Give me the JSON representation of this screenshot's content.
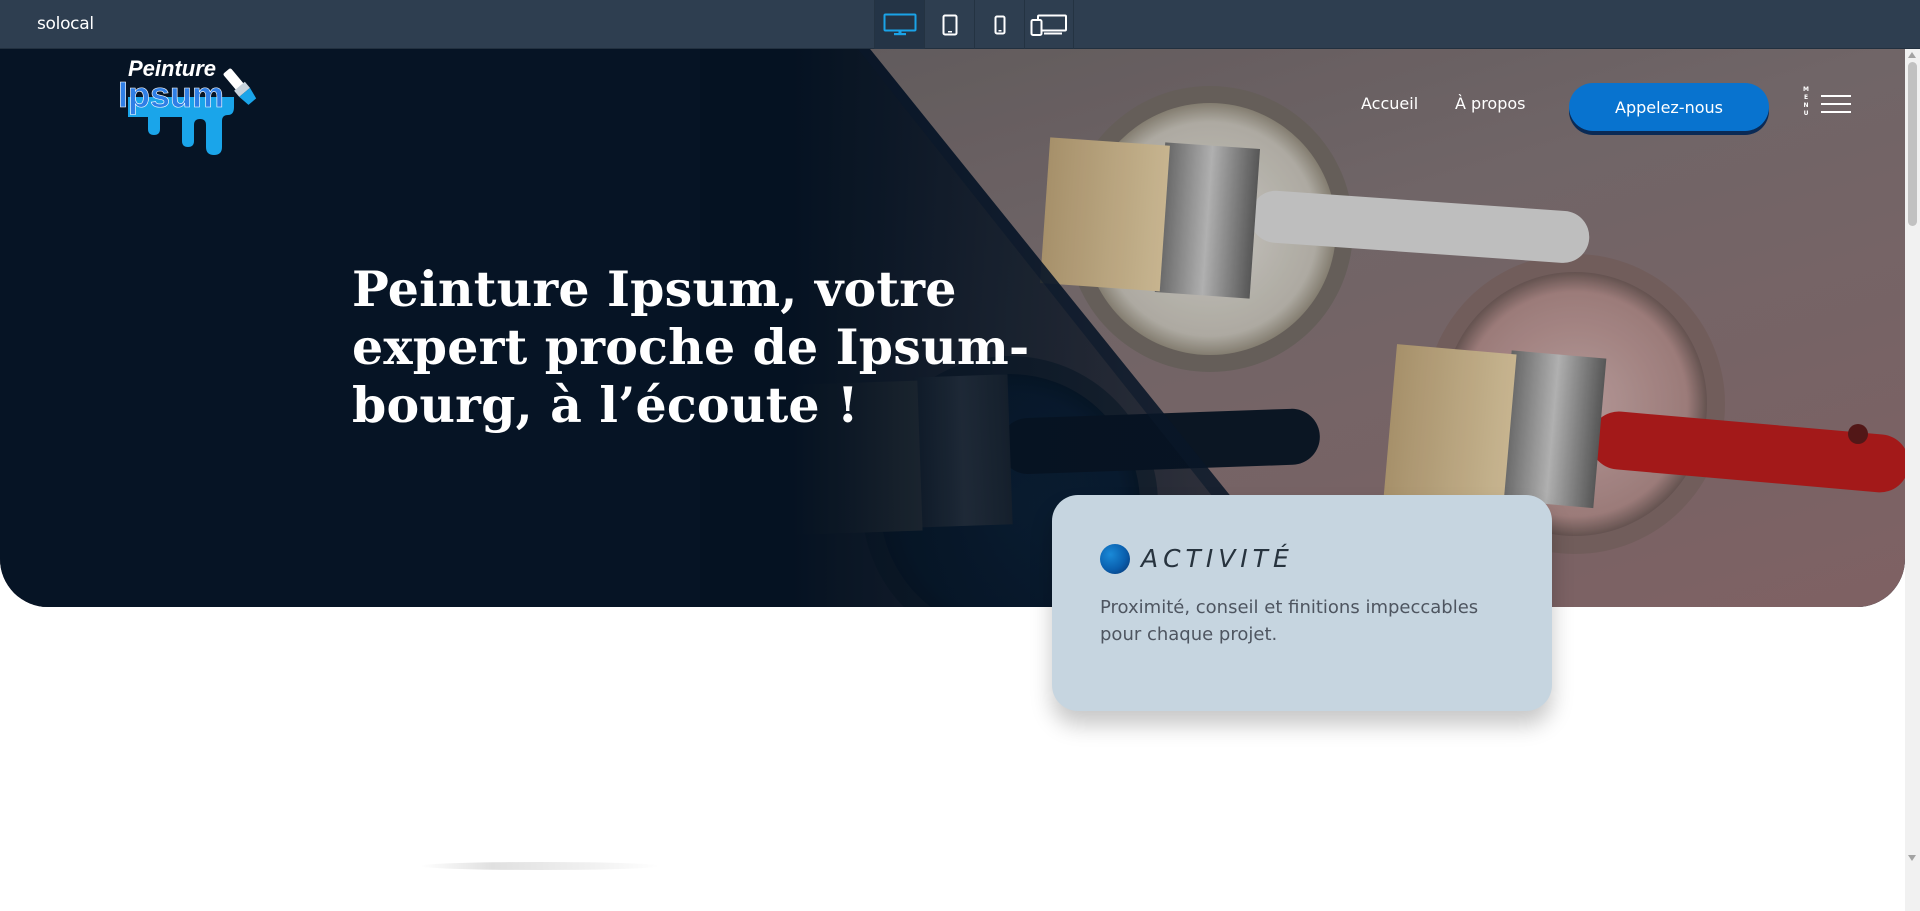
{
  "topbar": {
    "brand": "solocal",
    "devices": [
      {
        "name": "desktop",
        "icon": "desktop-icon",
        "active": true
      },
      {
        "name": "tablet",
        "icon": "tablet-icon",
        "active": false
      },
      {
        "name": "mobile",
        "icon": "mobile-icon",
        "active": false
      },
      {
        "name": "multi-device",
        "icon": "multi-device-icon",
        "active": false
      }
    ]
  },
  "site": {
    "logo": {
      "line1": "Peinture",
      "line2": "Ipsum"
    },
    "nav": {
      "home": "Accueil",
      "about": "À propos",
      "call_button": "Appelez-nous",
      "menu_word": "MENU"
    },
    "hero": {
      "title": "Peinture Ipsum, votre expert proche de Ipsum-bourg, à l’écoute !"
    },
    "activity": {
      "label": "ACTIVITÉ",
      "text": "Proximité, conseil et finitions impeccables pour chaque projet."
    }
  },
  "colors": {
    "topbar": "#2e3e50",
    "hero_dark": "#071627",
    "accent_blue": "#0873cf",
    "active_device": "#1aa3e8",
    "card_bg": "#c6d5e0"
  }
}
